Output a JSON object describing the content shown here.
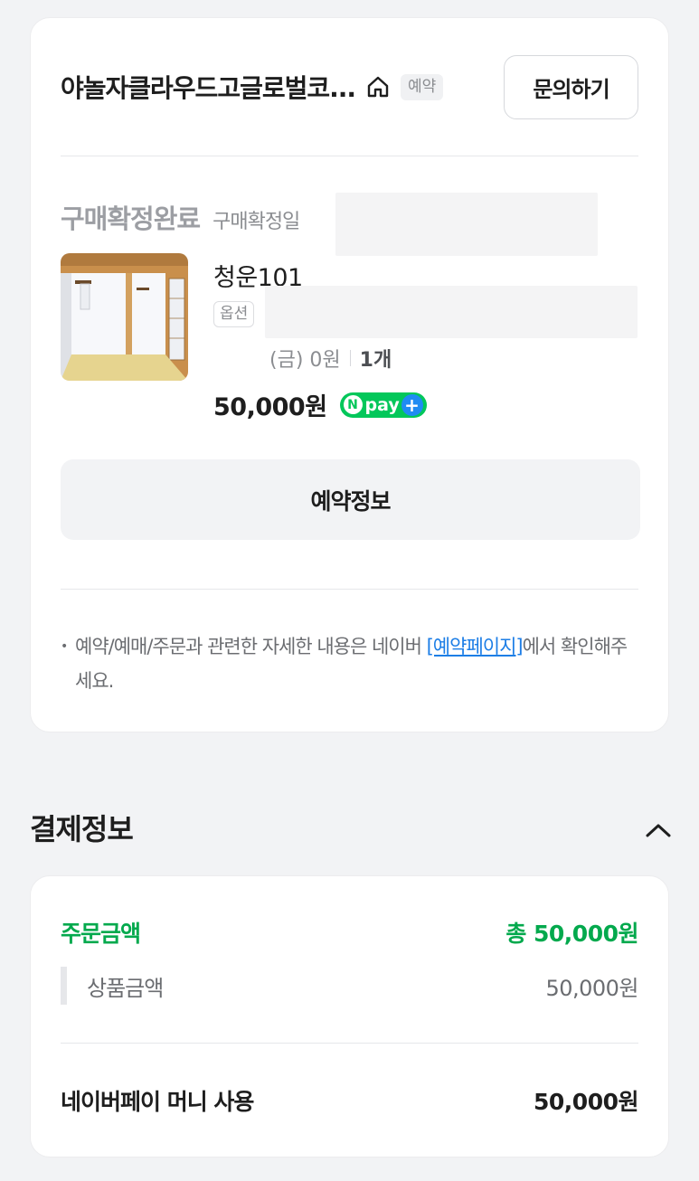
{
  "order_card": {
    "shop_name": "야놀자클라우드고글로벌코...",
    "reserve_badge": "예약",
    "inquiry_button": "문의하기",
    "status": "구매확정완료",
    "status_date_label": "구매확정일",
    "product": {
      "name": "청운101",
      "option_tag": "옵션",
      "option_price": "(금) 0원",
      "quantity": "1개",
      "price": "50,000원",
      "npay_badge": "pay"
    },
    "reservation_info_button": "예약정보",
    "notice": {
      "text_before": "예약/예매/주문과 관련한 자세한 내용은 네이버 ",
      "link": "[예약페이지]",
      "text_after": "에서 확인해주세요."
    }
  },
  "payment": {
    "title": "결제정보",
    "order_amount_label": "주문금액",
    "order_amount_total": "총 50,000원",
    "item_amount_label": "상품금액",
    "item_amount_value": "50,000원",
    "npay_money_label": "네이버페이 머니 사용",
    "npay_money_value": "50,000원"
  },
  "colors": {
    "accent_green": "#03a94d",
    "link_blue": "#1d7ee6",
    "npay_green": "#03c75a"
  },
  "icons": [
    "home-icon",
    "chevron-up-icon",
    "npay-logo"
  ]
}
